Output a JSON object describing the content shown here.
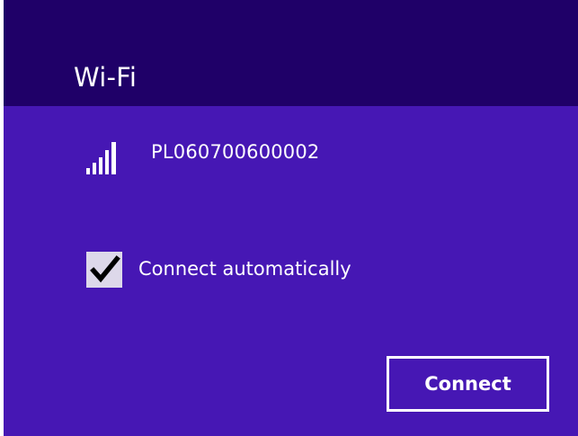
{
  "header": {
    "title": "Wi-Fi"
  },
  "network": {
    "ssid": "PL060700600002",
    "signal_icon": "wifi-signal-bars-icon",
    "signal_strength_bars": 5
  },
  "options": {
    "connect_automatically_label": "Connect automatically",
    "connect_automatically_checked": true,
    "checkbox_icon": "checkmark-icon"
  },
  "actions": {
    "connect_label": "Connect"
  },
  "colors": {
    "header_bg": "#1f0068",
    "panel_bg": "#4617b4",
    "text": "#ffffff",
    "checkbox_bg": "#ddd8ea",
    "checkmark": "#000000"
  }
}
